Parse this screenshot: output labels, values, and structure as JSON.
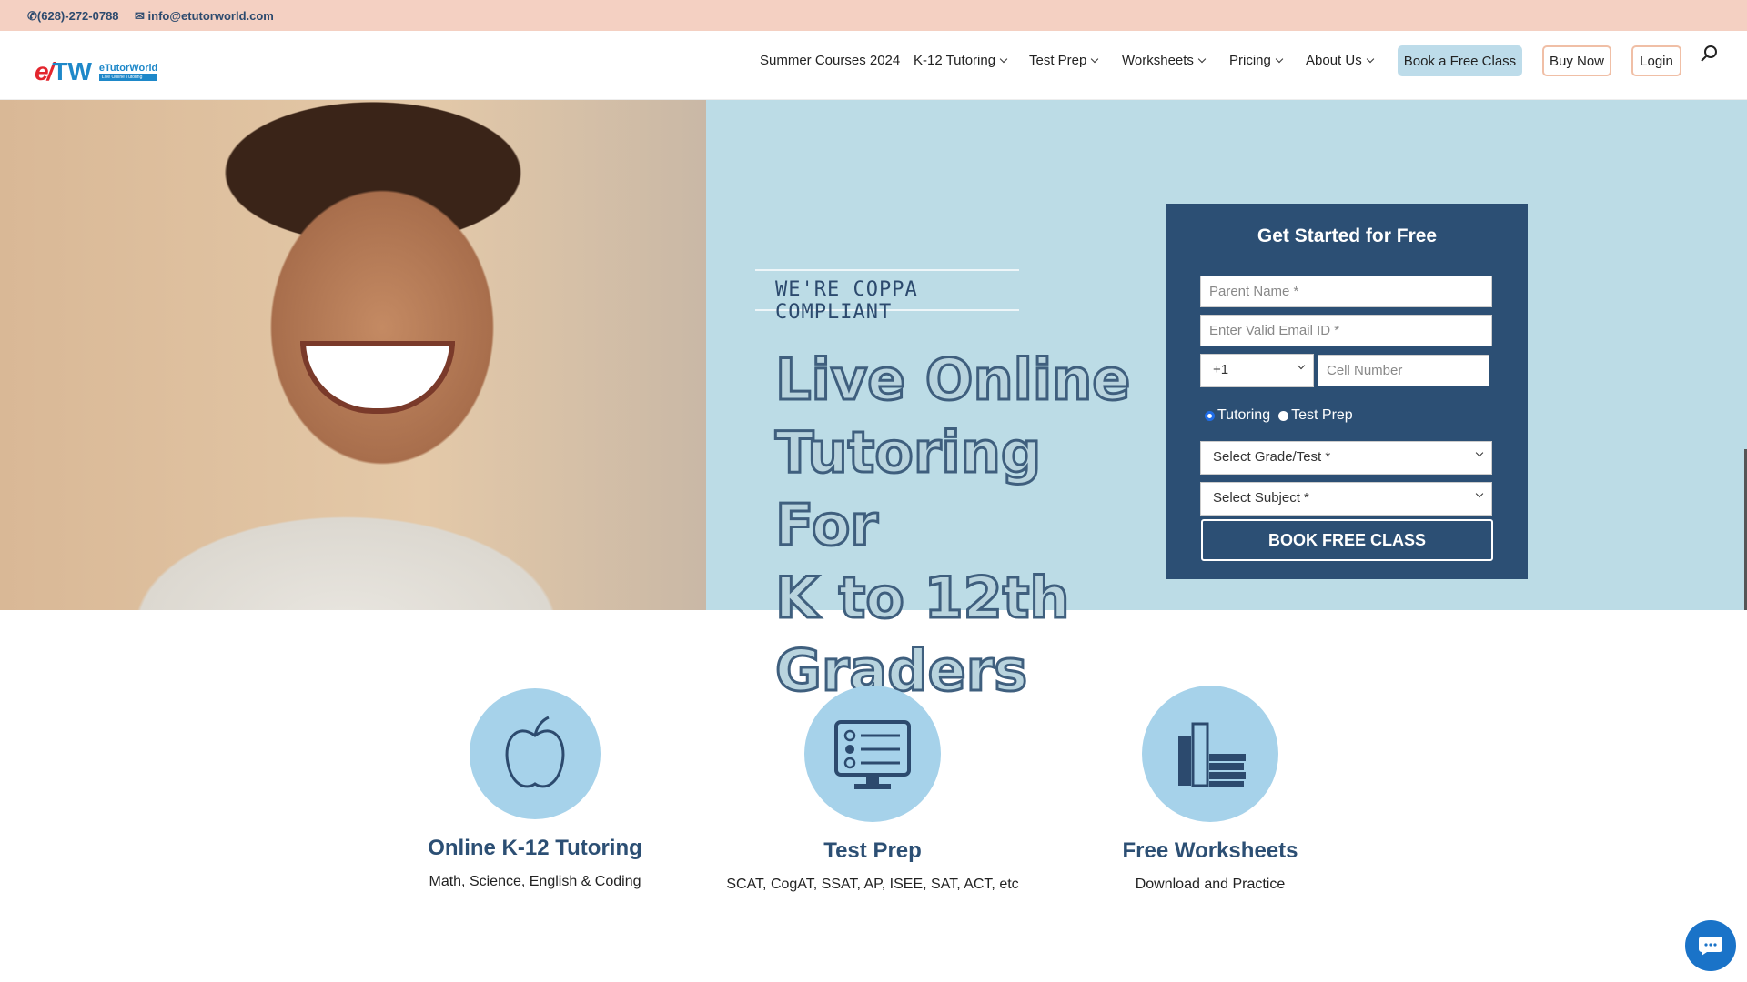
{
  "topbar": {
    "phone": "(628)-272-0788",
    "email": "info@etutorworld.com",
    "phone_icon": "phone-icon",
    "email_icon": "envelope-icon"
  },
  "logo": {
    "mark_e": "e/",
    "mark_tw": "TW",
    "name": "eTutorWorld",
    "tagline": "Live Online Tutoring"
  },
  "nav": {
    "items": [
      {
        "label": "Summer Courses 2024"
      },
      {
        "label": "K-12 Tutoring"
      },
      {
        "label": "Test Prep"
      },
      {
        "label": "Worksheets"
      },
      {
        "label": "Pricing"
      },
      {
        "label": "About Us"
      }
    ],
    "book_label": "Book a Free Class",
    "buy_label": "Buy Now",
    "login_label": "Login",
    "colors": {
      "book_bg": "#bddcea",
      "outline": "#f0bfa6"
    }
  },
  "hero": {
    "coppa": "WE'RE COPPA COMPLIANT",
    "headline": [
      "Live Online",
      "Tutoring For",
      "K to 12th",
      "Graders"
    ]
  },
  "form": {
    "title": "Get Started for Free",
    "parent_placeholder": "Parent Name *",
    "email_placeholder": "Enter Valid Email ID *",
    "country_code": "+1",
    "cell_placeholder": "Cell Number",
    "radio_tutoring": "Tutoring",
    "radio_testprep": "Test Prep",
    "selected_radio": "Tutoring",
    "grade_select": "Select Grade/Test *",
    "subject_select": "Select Subject *",
    "submit_label": "BOOK FREE CLASS",
    "bg": "#2c4f74"
  },
  "features": [
    {
      "icon": "apple-icon",
      "title": "Online K-12 Tutoring",
      "subtitle": "Math, Science, English & Coding"
    },
    {
      "icon": "monitor-checklist-icon",
      "title": "Test Prep",
      "subtitle": "SCAT, CogAT, SSAT, AP, ISEE, SAT, ACT, etc"
    },
    {
      "icon": "books-icon",
      "title": "Free Worksheets",
      "subtitle": "Download and Practice"
    }
  ]
}
